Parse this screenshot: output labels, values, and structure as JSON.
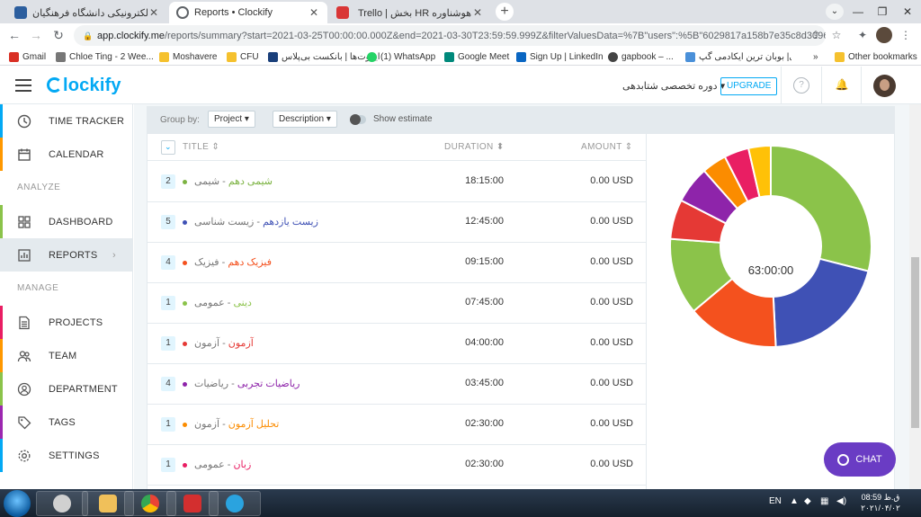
{
  "browser": {
    "tabs": [
      {
        "title": "سامانه آموزش الکترونیکی دانشگاه فرهنگیان",
        "active": false,
        "favicon_color": "#2c5e9e"
      },
      {
        "title": "Reports • Clockify",
        "active": true,
        "favicon_color": "#03a9f4"
      },
      {
        "title": "Trello | بخش HR هوشناوره",
        "active": false,
        "favicon_color": "#d93636"
      }
    ],
    "url_host": "app.clockify.me",
    "url_path": "/reports/summary?start=2021-03-25T00:00:00.000Z&end=2021-03-30T23:59:59.999Z&filterValuesData=%7B\"users\":%5B\"6029817a158b7e35c8d30969\"...",
    "bookmarks": [
      {
        "label": "Gmail",
        "color": "#d93025"
      },
      {
        "label": "Chloe Ting - 2 Wee...",
        "color": "#777777"
      },
      {
        "label": "Moshavere",
        "color": "#f5c12e"
      },
      {
        "label": "CFU",
        "color": "#f5c12e"
      },
      {
        "label": "ایزوت‌ها | بانکست بی‌پلاس",
        "color": "#1a3f7a"
      },
      {
        "label": "(1) WhatsApp",
        "color": "#25d366"
      },
      {
        "label": "Google Meet",
        "color": "#00897b"
      },
      {
        "label": "Sign Up | LinkedIn",
        "color": "#0a66c2"
      },
      {
        "label": "gapbook – ...",
        "color": "#444444"
      },
      {
        "label": "رمضانی| بوبان ترین ایکادمی گپ...",
        "color": "#4a90d9"
      }
    ],
    "other_bookmarks": "Other bookmarks"
  },
  "app": {
    "logo": "lockify",
    "workspace": "دوره تخصصی شتابدهی",
    "upgrade_label": "UPGRADE"
  },
  "sidebar": {
    "items": [
      {
        "label": "TIME TRACKER",
        "icon": "clock-icon",
        "stripe": "#03a9f4"
      },
      {
        "label": "CALENDAR",
        "icon": "calendar-icon",
        "stripe": "#ff9800"
      },
      {
        "label": "DASHBOARD",
        "icon": "dashboard-icon",
        "stripe": "#8bc34a"
      },
      {
        "label": "REPORTS",
        "icon": "reports-icon",
        "stripe": "#03a9f4"
      },
      {
        "label": "PROJECTS",
        "icon": "projects-icon",
        "stripe": "#e91e63"
      },
      {
        "label": "TEAM",
        "icon": "team-icon",
        "stripe": "#ff9800"
      },
      {
        "label": "DEPARTMENT",
        "icon": "department-icon",
        "stripe": "#8bc34a"
      },
      {
        "label": "TAGS",
        "icon": "tags-icon",
        "stripe": "#9c27b0"
      },
      {
        "label": "SETTINGS",
        "icon": "settings-icon",
        "stripe": "#03a9f4"
      }
    ],
    "section_analyze": "ANALYZE",
    "section_manage": "MANAGE"
  },
  "filters": {
    "group_by_label": "Group by:",
    "group_primary": "Project",
    "group_secondary": "Description",
    "show_estimate": "Show estimate"
  },
  "table": {
    "headers": {
      "title": "TITLE",
      "duration": "DURATION",
      "amount": "AMOUNT"
    },
    "rows": [
      {
        "count": "2",
        "project": "شیمی دهم",
        "client": " - شیمی",
        "duration": "18:15:00",
        "amount": "0.00 USD",
        "color": "#7cb342"
      },
      {
        "count": "5",
        "project": "زیست یازدهم",
        "client": " - زیست شناسی",
        "duration": "12:45:00",
        "amount": "0.00 USD",
        "color": "#3f51b5"
      },
      {
        "count": "4",
        "project": "فیزیک دهم",
        "client": " - فیزیک",
        "duration": "09:15:00",
        "amount": "0.00 USD",
        "color": "#f4511e"
      },
      {
        "count": "1",
        "project": "دینی",
        "client": " - عمومی",
        "duration": "07:45:00",
        "amount": "0.00 USD",
        "color": "#8bc34a"
      },
      {
        "count": "1",
        "project": "آزمون",
        "client": " - آزمون",
        "duration": "04:00:00",
        "amount": "0.00 USD",
        "color": "#e53935"
      },
      {
        "count": "4",
        "project": "ریاضیات تجربی",
        "client": " - ریاضیات",
        "duration": "03:45:00",
        "amount": "0.00 USD",
        "color": "#8e24aa"
      },
      {
        "count": "1",
        "project": "تحلیل آزمون",
        "client": " - آزمون",
        "duration": "02:30:00",
        "amount": "0.00 USD",
        "color": "#fb8c00"
      },
      {
        "count": "1",
        "project": "زبان",
        "client": " - عمومی",
        "duration": "02:30:00",
        "amount": "0.00 USD",
        "color": "#e91e63"
      }
    ]
  },
  "chart_data": {
    "type": "pie",
    "center_label": "63:00:00",
    "categories": [
      "شیمی دهم",
      "زیست یازدهم",
      "فیزیک دهم",
      "دینی",
      "آزمون",
      "ریاضیات تجربی",
      "تحلیل آزمون",
      "زبان",
      "other"
    ],
    "values": [
      18.25,
      12.75,
      9.25,
      7.75,
      4.0,
      3.75,
      2.5,
      2.5,
      2.25
    ],
    "colors": [
      "#8bc34a",
      "#3f51b5",
      "#f4511e",
      "#8bc34a",
      "#e53935",
      "#8e24aa",
      "#fb8c00",
      "#e91e63",
      "#ffc107"
    ]
  },
  "chat_label": "CHAT",
  "taskbar": {
    "lang": "EN",
    "time": "08:59 ق.ظ",
    "date": "۲۰۲۱/۰۴/۰۲"
  }
}
